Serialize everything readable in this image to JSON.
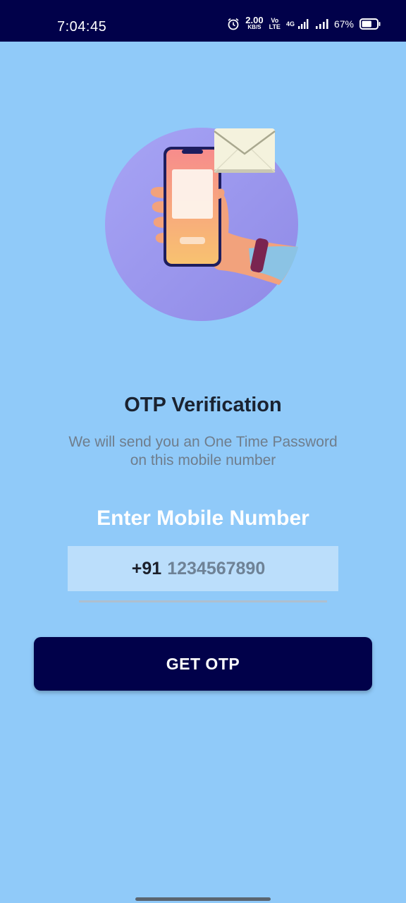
{
  "status_bar": {
    "time": "7:04:45",
    "net_speed_value": "2.00",
    "net_speed_unit": "KB/S",
    "volte_top": "Vo",
    "volte_bottom": "LTE",
    "net_type": "4G",
    "battery": "67%",
    "battery_level_pct": 67,
    "icons": [
      "alarm-icon",
      "signal-icon",
      "signal-icon",
      "battery-icon"
    ]
  },
  "hero": {
    "icon": "phone-message-illustration"
  },
  "main": {
    "title": "OTP Verification",
    "subtitle_line1": "We will send you an One Time Password",
    "subtitle_line2": "on this mobile number",
    "label": "Enter Mobile Number",
    "country_code": "+91",
    "phone_placeholder": "1234567890",
    "button_label": "GET OTP"
  },
  "colors": {
    "background": "#90CAF9",
    "accent": "#01014A",
    "field_background": "#BBDEFB"
  }
}
